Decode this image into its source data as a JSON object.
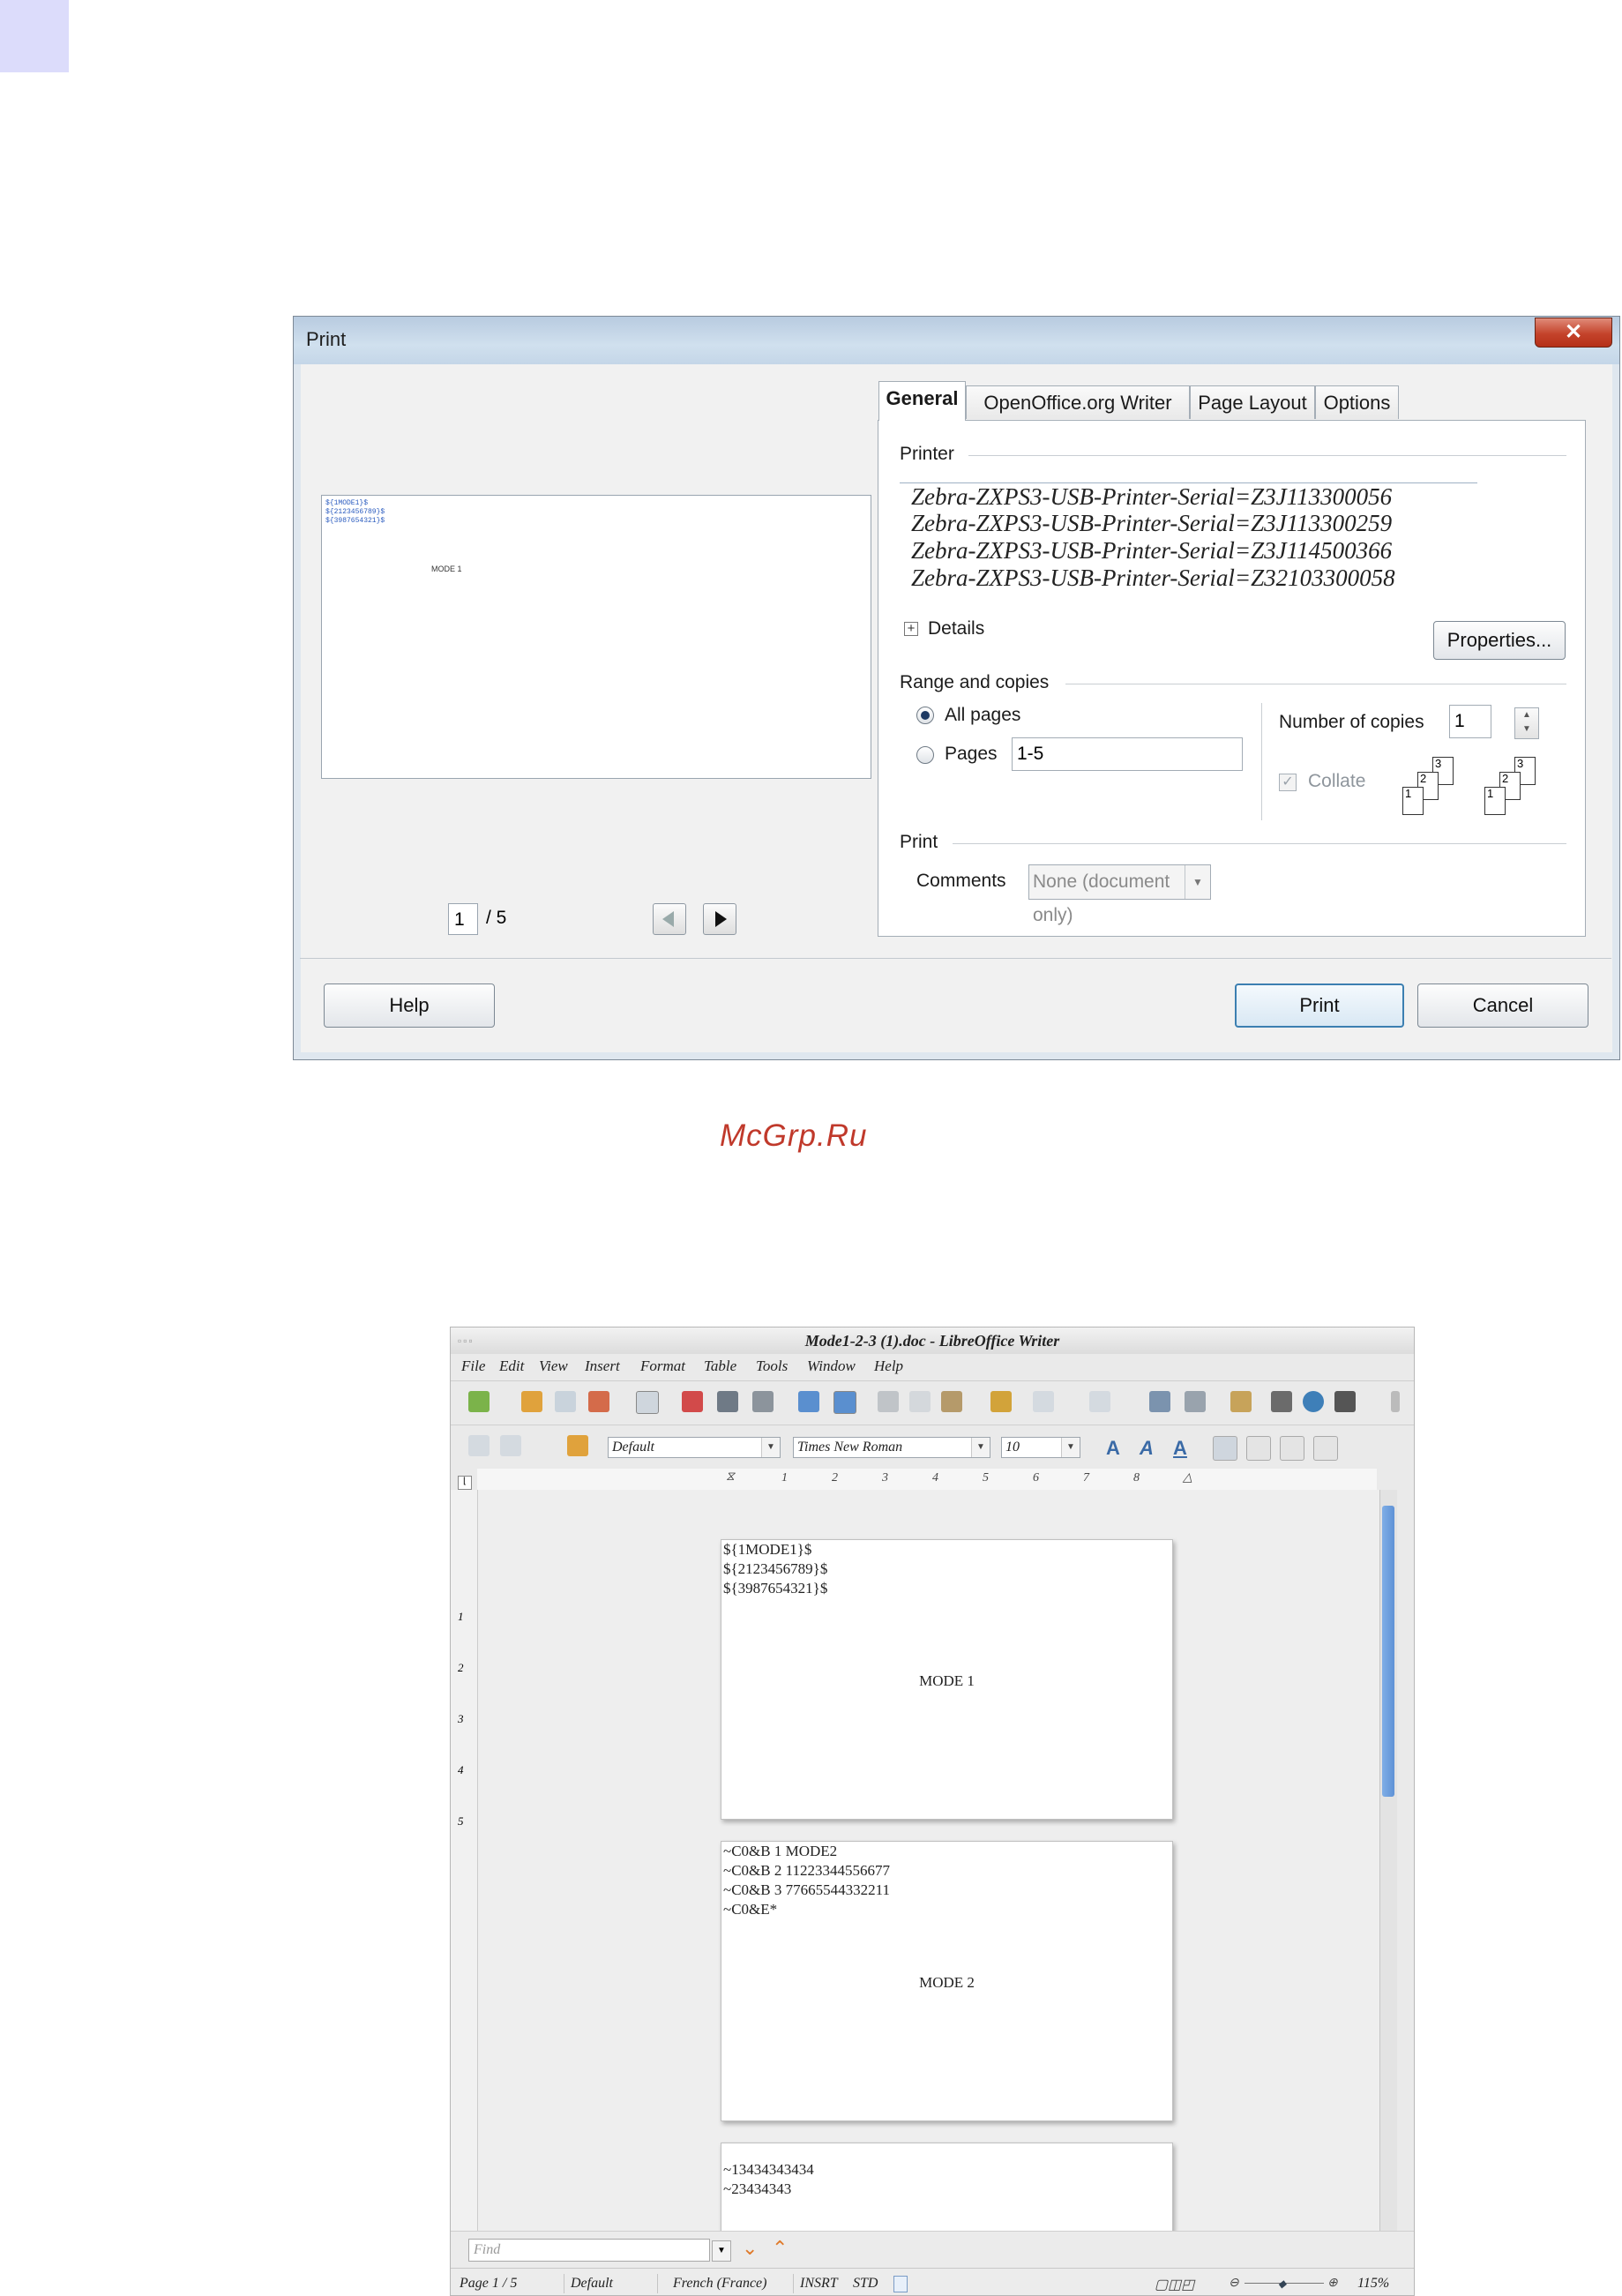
{
  "print_dialog": {
    "title": "Print",
    "close_glyph": "✕",
    "tabs": [
      {
        "label": "General"
      },
      {
        "label": "OpenOffice.org Writer"
      },
      {
        "label": "Page Layout"
      },
      {
        "label": "Options"
      }
    ],
    "preview": {
      "lines": [
        "${1MODE1}$",
        "${2123456789}$",
        "${3987654321}$"
      ],
      "mode_text": "MODE 1",
      "current_page": "1",
      "total_pages": "/ 5"
    },
    "printer_section": {
      "label": "Printer",
      "printers": [
        "Zebra-ZXPS3-USB-Printer-Serial=Z3J113300056",
        "Zebra-ZXPS3-USB-Printer-Serial=Z3J113300259",
        "Zebra-ZXPS3-USB-Printer-Serial=Z3J114500366",
        "Zebra-ZXPS3-USB-Printer-Serial=Z32103300058"
      ],
      "details_label": "Details",
      "properties_button": "Properties..."
    },
    "range_section": {
      "label": "Range and copies",
      "all_pages_label": "All pages",
      "pages_label": "Pages",
      "pages_value": "1-5",
      "copies_label": "Number of copies",
      "copies_value": "1",
      "collate_label": "Collate",
      "collate_icon_labels": [
        "1",
        "2",
        "3"
      ]
    },
    "print_section": {
      "label": "Print",
      "comments_label": "Comments",
      "comments_value": "None (document only)"
    },
    "buttons": {
      "help": "Help",
      "print": "Print",
      "cancel": "Cancel"
    }
  },
  "watermark": "McGrp.Ru",
  "writer": {
    "title": "Mode1-2-3 (1).doc - LibreOffice Writer",
    "menu": [
      "File",
      "Edit",
      "View",
      "Insert",
      "Format",
      "Table",
      "Tools",
      "Window",
      "Help"
    ],
    "paragraph_style": "Default",
    "font_name": "Times New Roman",
    "font_size": "10",
    "ruler_marks": [
      "1",
      "2",
      "3",
      "4",
      "5",
      "6",
      "7",
      "8"
    ],
    "vertical_ruler_marks": [
      "1",
      "2",
      "3",
      "4",
      "5"
    ],
    "pages": [
      {
        "lines": [
          "${1MODE1}$",
          "${2123456789}$",
          "${3987654321}$"
        ],
        "mode": "MODE 1"
      },
      {
        "lines": [
          "~C0&B 1 MODE2",
          "~C0&B 2 11223344556677",
          "~C0&B 3 77665544332211",
          "~C0&E*"
        ],
        "mode": "MODE 2"
      },
      {
        "lines": [
          "~13434343434",
          "~23434343"
        ],
        "mode": ""
      }
    ],
    "find_placeholder": "Find",
    "status": {
      "page": "Page 1 / 5",
      "style": "Default",
      "language": "French (France)",
      "insert_mode": "INSRT",
      "selection_mode": "STD",
      "zoom": "115%"
    }
  }
}
